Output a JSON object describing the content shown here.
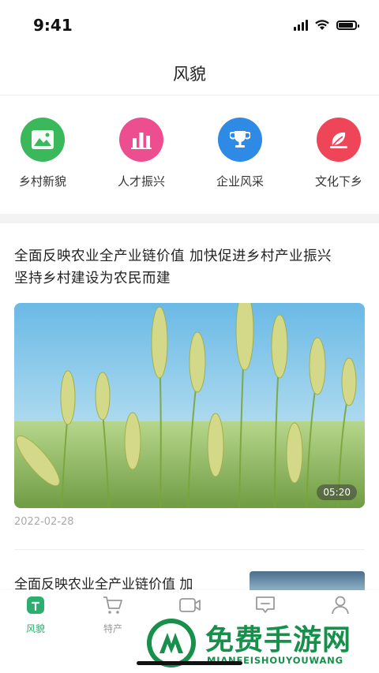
{
  "status_bar": {
    "time": "9:41"
  },
  "nav": {
    "title": "风貌"
  },
  "categories": [
    {
      "label": "乡村新貌",
      "icon": "landscape-icon",
      "color": "#3cb85c"
    },
    {
      "label": "人才振兴",
      "icon": "bar-chart-icon",
      "color": "#ec4e8f"
    },
    {
      "label": "企业风采",
      "icon": "trophy-icon",
      "color": "#2f8ae6"
    },
    {
      "label": "文化下乡",
      "icon": "leaf-icon",
      "color": "#ef4558"
    }
  ],
  "feed": {
    "article1": {
      "title_line1": "全面反映农业全产业链价值 加快促进乡村产业振兴",
      "title_line2": "坚持乡村建设为农民而建",
      "duration": "05:20",
      "date": "2022-02-28"
    },
    "article2": {
      "title": "全面反映农业全产业链价值 加"
    }
  },
  "tabbar": {
    "tabs": [
      {
        "label": "风貌",
        "icon": "home-icon",
        "active": true
      },
      {
        "label": "特产",
        "icon": "cart-icon",
        "active": false
      },
      {
        "label": "",
        "icon": "video-icon",
        "active": false
      },
      {
        "label": "",
        "icon": "message-icon",
        "active": false
      },
      {
        "label": "",
        "icon": "user-icon",
        "active": false
      }
    ]
  },
  "watermark": {
    "title": "免费手游网",
    "subtitle": "MIANFEISHOUYOUWANG"
  },
  "colors": {
    "accent": "#2cae6e",
    "watermark": "#16904a"
  }
}
